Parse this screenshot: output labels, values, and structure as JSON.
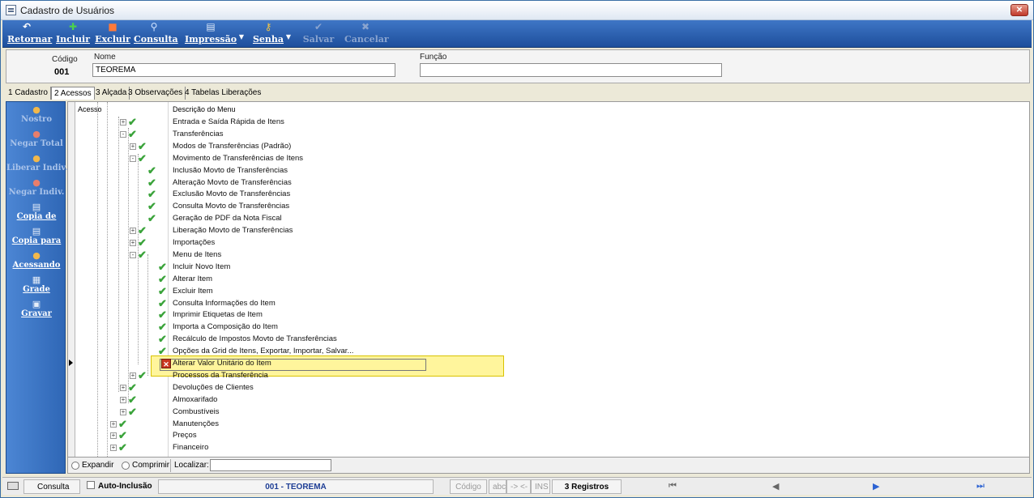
{
  "window": {
    "title": "Cadastro de Usuários",
    "close_glyph": "✕"
  },
  "toolbar": {
    "retornar": "Retornar",
    "incluir": "Incluir",
    "excluir": "Excluir",
    "consulta": "Consulta",
    "impressao": "Impressão",
    "senha": "Senha",
    "salvar": "Salvar",
    "cancelar": "Cancelar",
    "dropdown_glyph": "▼"
  },
  "header": {
    "codigo_label": "Código",
    "codigo_value": "001",
    "nome_label": "Nome",
    "nome_value": "TEOREMA",
    "funcao_label": "Função",
    "funcao_value": ""
  },
  "tabs": [
    "1 Cadastro",
    "2 Acessos",
    "3 Alçada",
    "3 Observações",
    "4 Tabelas Liberações"
  ],
  "side_buttons": {
    "nostro": "Nostro",
    "negar_total": "Negar Total",
    "liberar_indiv": "Liberar Indiv.",
    "negar_indiv": "Negar Indiv.",
    "copia_de": "Copia de",
    "copia_para": "Copia para",
    "acessando": "Acessando",
    "grade": "Grade",
    "gravar": "Gravar"
  },
  "grid": {
    "col_acesso": "Acesso",
    "col_desc": "Descrição do Menu",
    "rows": [
      "Entrada e Saída Rápida de Itens",
      "Transferências",
      "Modos de Transferências (Padrão)",
      "Movimento de Transferências de Itens",
      "Inclusão Movto de Transferências",
      "Alteração Movto de Transferências",
      "Exclusão Movto de Transferências",
      "Consulta Movto de Transferências",
      "Geração de PDF da Nota Fiscal",
      "Liberação Movto de Transferências",
      "Importações",
      "Menu de Itens",
      "Incluir Novo Item",
      "Alterar Item",
      "Excluir Item",
      "Consulta Informações do Item",
      "Imprimir Etiquetas de Item",
      "Importa a Composição do Item",
      "Recálculo de Impostos Movto de Transferências",
      "Opções da Grid de Itens, Exportar, Importar, Salvar...",
      "Alterar Valor Unitário do Item",
      "Processos da Transferência",
      "Devoluções de Clientes",
      "Almoxarifado",
      "Combustíveis",
      "Manutenções",
      "Preços",
      "Financeiro"
    ]
  },
  "footer": {
    "expandir": "Expandir",
    "comprimir": "Comprimir",
    "localizar": "Localizar:"
  },
  "status": {
    "consulta": "Consulta",
    "auto_inclusao": "Auto-Inclusão",
    "user": "001 - TEOREMA",
    "codigo": "Código",
    "abc": "abc",
    "arrows": "-> <-",
    "ins": "INS",
    "registros": "3 Registros"
  }
}
